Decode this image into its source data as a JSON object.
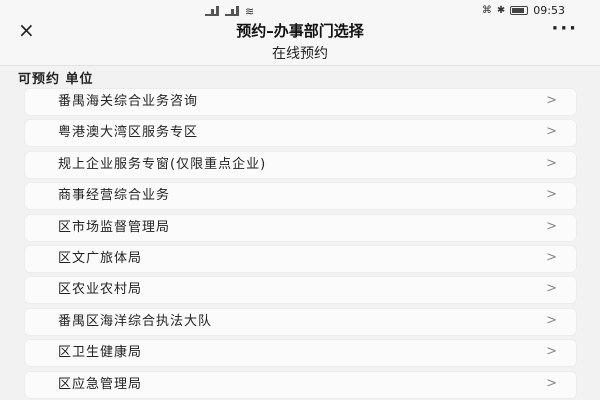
{
  "status": {
    "time": "09:53",
    "signal1": "4G",
    "signal2": "5G"
  },
  "nav": {
    "title": "预约–办事部门选择",
    "close": "×",
    "more": "···"
  },
  "subheader": {
    "title": "在线预约"
  },
  "section": {
    "label": "可预约 单位"
  },
  "items": [
    {
      "label": "番禺海关综合业务咨询"
    },
    {
      "label": "粤港澳大湾区服务专区"
    },
    {
      "label": "规上企业服务专窗(仅限重点企业)"
    },
    {
      "label": "商事经营综合业务"
    },
    {
      "label": "区市场监督管理局"
    },
    {
      "label": "区文广旅体局"
    },
    {
      "label": "区农业农村局"
    },
    {
      "label": "番禺区海洋综合执法大队"
    },
    {
      "label": "区卫生健康局"
    },
    {
      "label": "区应急管理局"
    }
  ],
  "chevron": ">"
}
